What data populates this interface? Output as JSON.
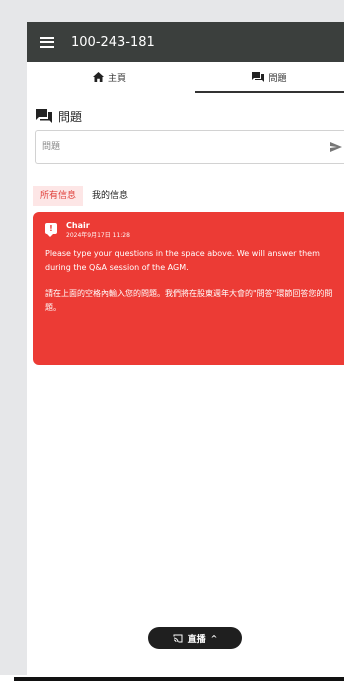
{
  "header": {
    "title": "100-243-181"
  },
  "tabs": [
    {
      "label": "主頁",
      "icon": "home-icon"
    },
    {
      "label": "問題",
      "icon": "chat-icon"
    }
  ],
  "questions": {
    "section_title": "問題",
    "input_placeholder": "問題",
    "send_icon": "send-icon"
  },
  "filters": {
    "all": "所有信息",
    "mine": "我的信息"
  },
  "message": {
    "badge": "!",
    "author": "Chair",
    "timestamp": "2024年9月17日 11:28",
    "body_en": "Please type your questions in the space above.  We will answer them during the Q&A session of the AGM.",
    "body_zh": "請在上面的空格內輸入您的問題。我們將在股東週年大會的\"問答\"環節回答您的問題。",
    "color": "#ec3b35"
  },
  "live": {
    "label": "直播",
    "chevron": "^"
  },
  "colors": {
    "header_bg": "#3b3f3d",
    "accent": "#e0403b",
    "live_bg": "#1f1f1f"
  }
}
